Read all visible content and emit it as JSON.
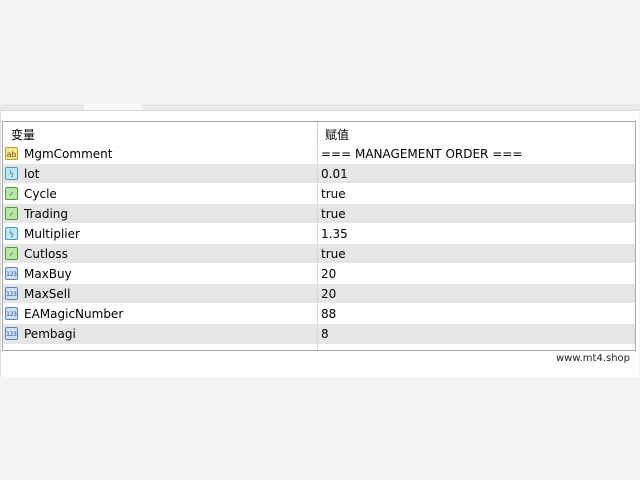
{
  "header": {
    "col_name": "变量",
    "col_value": "赋值"
  },
  "rows": [
    {
      "icon": "string-icon",
      "badge": "ab",
      "name": "MgmComment",
      "value": "=== MANAGEMENT ORDER ==="
    },
    {
      "icon": "double-icon",
      "badge": "½",
      "name": "lot",
      "value": "0.01"
    },
    {
      "icon": "bool-icon",
      "badge": "✓",
      "name": "Cycle",
      "value": "true"
    },
    {
      "icon": "bool-icon",
      "badge": "✓",
      "name": "Trading",
      "value": "true"
    },
    {
      "icon": "double-icon",
      "badge": "½",
      "name": "Multiplier",
      "value": "1.35"
    },
    {
      "icon": "bool-icon",
      "badge": "✓",
      "name": "Cutloss",
      "value": "true"
    },
    {
      "icon": "int-icon",
      "badge": "123",
      "name": "MaxBuy",
      "value": "20"
    },
    {
      "icon": "int-icon",
      "badge": "123",
      "name": "MaxSell",
      "value": "20"
    },
    {
      "icon": "int-icon",
      "badge": "123",
      "name": "EAMagicNumber",
      "value": "88"
    },
    {
      "icon": "int-icon",
      "badge": "123",
      "name": "Pembagi",
      "value": "8"
    }
  ],
  "watermark": "www.mt4.shop"
}
